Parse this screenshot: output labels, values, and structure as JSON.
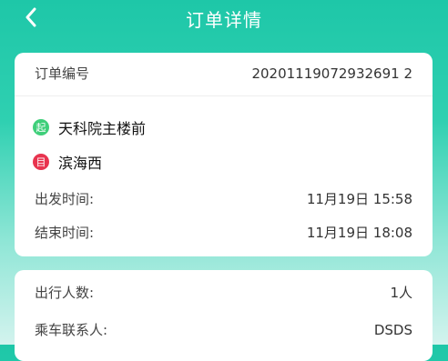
{
  "header": {
    "title": "订单详情",
    "back_icon": "chevron-left-icon"
  },
  "order": {
    "number_label": "订单编号",
    "number_value": "20201119072932691 2",
    "from_badge": "起",
    "from_badge_color": "#3fcf7a",
    "from_place": "天科院主楼前",
    "to_badge": "目",
    "to_badge_color": "#e8344f",
    "to_place": "滨海西",
    "depart_label": "出发时间:",
    "depart_value": "11月19日 15:58",
    "end_label": "结束时间:",
    "end_value": "11月19日 18:08"
  },
  "trip": {
    "people_label": "出行人数:",
    "people_value": "1人",
    "contact_label": "乘车联系人:",
    "contact_value": "DSDS"
  },
  "colors": {
    "accent": "#1ec7a8"
  }
}
